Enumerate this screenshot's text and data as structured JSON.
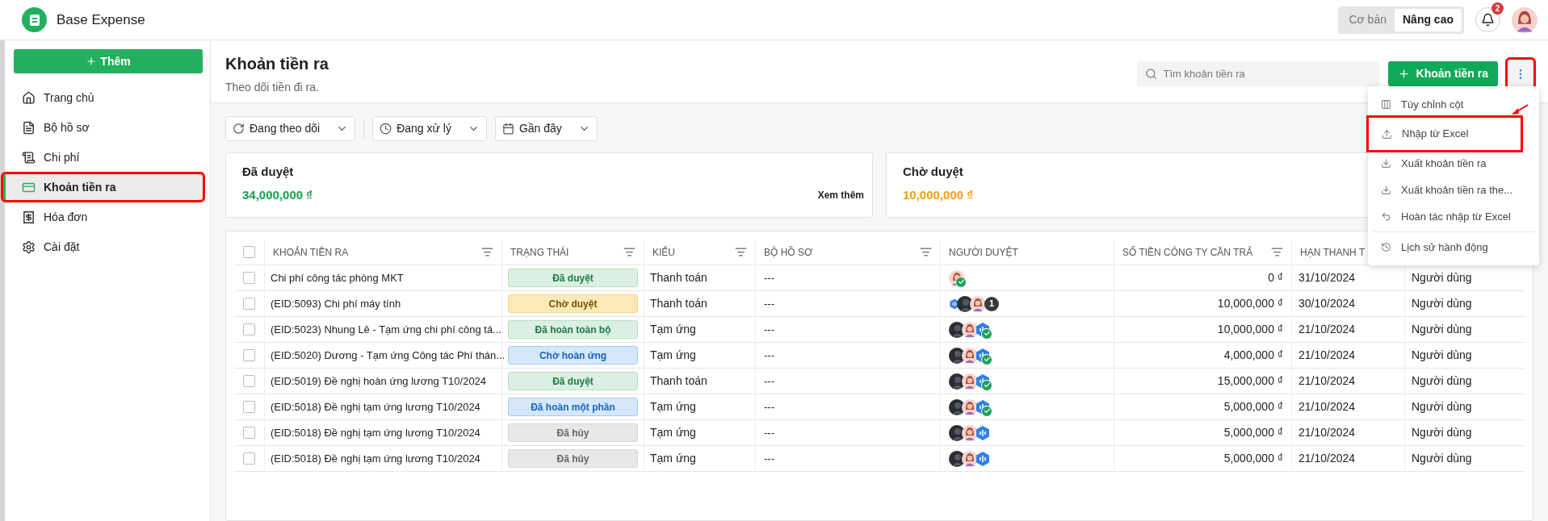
{
  "app": {
    "title": "Base Expense"
  },
  "mode_switch": [
    {
      "label": "Cơ bản",
      "selected": false
    },
    {
      "label": "Nâng cao",
      "selected": true
    }
  ],
  "notifications": {
    "count": "2"
  },
  "sidebar": {
    "add_button": "Thêm",
    "items": [
      {
        "label": "Trang chủ",
        "selected": false,
        "highlighted": false
      },
      {
        "label": "Bộ hồ sơ",
        "selected": false,
        "highlighted": false
      },
      {
        "label": "Chi phí",
        "selected": false,
        "highlighted": false
      },
      {
        "label": "Khoản tiền ra",
        "selected": true,
        "highlighted": true
      },
      {
        "label": "Hóa đơn",
        "selected": false,
        "highlighted": false
      },
      {
        "label": "Cài đặt",
        "selected": false,
        "highlighted": false
      }
    ]
  },
  "page": {
    "title": "Khoản tiền ra",
    "subtitle": "Theo dõi tiền đi ra.",
    "search": {
      "placeholder": "Tìm khoản tiền ra"
    },
    "add_button": "Khoản tiền ra",
    "more_highlighted": true
  },
  "filters": [
    {
      "label": "Đang theo dõi"
    },
    {
      "label": "Đang xử lý"
    },
    {
      "label": "Gần đây"
    }
  ],
  "summary_cards": [
    {
      "title": "Đã duyệt",
      "amount": "34,000,000 ₫",
      "color": "#16a34a",
      "link": "Xem thêm"
    },
    {
      "title": "Chờ duyệt",
      "amount": "10,000,000 ₫",
      "color": "#f59e0b"
    }
  ],
  "menu": [
    {
      "label": "Tùy chỉnh cột",
      "highlighted": false
    },
    {
      "label": "Nhập từ Excel",
      "highlighted": true
    },
    {
      "label": "Xuất khoản tiền ra",
      "highlighted": false
    },
    {
      "label": "Xuất khoản tiền ra the...",
      "highlighted": false
    },
    {
      "label": "Hoàn tác nhập từ Excel",
      "highlighted": false
    },
    {
      "label": "Lịch sử hành động",
      "highlighted": false
    }
  ],
  "table": {
    "all_checked": false,
    "columns": [
      {
        "label": "KHOẢN TIỀN RA",
        "filter": true
      },
      {
        "label": "TRẠNG THÁI",
        "filter": true
      },
      {
        "label": "KIỂU",
        "filter": true
      },
      {
        "label": "BỘ HỒ SƠ",
        "filter": true
      },
      {
        "label": "NGƯỜI DUYỆT",
        "filter": false
      },
      {
        "label": "SỐ TIỀN CÔNG TY CẦN TRẢ",
        "filter": true
      },
      {
        "label": "HẠN THANH T",
        "filter": false
      }
    ],
    "rows": [
      {
        "checked": false,
        "title": "Chi phí công tác phòng MKT",
        "status": {
          "label": "Đã duyệt",
          "kind": "green"
        },
        "type": "Thanh toán",
        "file": "---",
        "approvers": [
          {
            "kind": "light"
          }
        ],
        "approved": true,
        "amount": "0 ₫",
        "due": "31/10/2024",
        "column_9": "Người dùng"
      },
      {
        "checked": false,
        "title": "(EID:5093) Chi phí máy tính",
        "status": {
          "label": "Chờ duyệt",
          "kind": "yellow"
        },
        "type": "Thanh toán",
        "file": "---",
        "approvers": [
          {
            "kind": "hex-small"
          },
          {
            "kind": "dark"
          },
          {
            "kind": "light"
          }
        ],
        "more": "1",
        "approved": false,
        "amount": "10,000,000 ₫",
        "due": "30/10/2024",
        "column_9": "Người dùng"
      },
      {
        "checked": false,
        "title": "(EID:5023) Nhung Lê - Tạm ứng chi phí công tá...",
        "status": {
          "label": "Đã hoàn toàn bộ",
          "kind": "green"
        },
        "type": "Tạm ứng",
        "file": "---",
        "approvers": [
          {
            "kind": "dark"
          },
          {
            "kind": "light"
          },
          {
            "kind": "hex"
          }
        ],
        "approved": true,
        "amount": "10,000,000 ₫",
        "due": "21/10/2024",
        "column_9": "Người dùng"
      },
      {
        "checked": false,
        "title": "(EID:5020) Dương - Tạm ứng Công tác Phí thán...",
        "status": {
          "label": "Chờ hoàn ứng",
          "kind": "blue"
        },
        "type": "Tạm ứng",
        "file": "---",
        "approvers": [
          {
            "kind": "dark"
          },
          {
            "kind": "light"
          },
          {
            "kind": "hex"
          }
        ],
        "approved": true,
        "amount": "4,000,000 ₫",
        "due": "21/10/2024",
        "column_9": "Người dùng"
      },
      {
        "checked": false,
        "title": "(EID:5019) Đề nghị hoàn ứng lương T10/2024",
        "status": {
          "label": "Đã duyệt",
          "kind": "green"
        },
        "type": "Thanh toán",
        "file": "---",
        "approvers": [
          {
            "kind": "dark"
          },
          {
            "kind": "light"
          },
          {
            "kind": "hex"
          }
        ],
        "approved": true,
        "amount": "15,000,000 ₫",
        "due": "21/10/2024",
        "column_9": "Người dùng"
      },
      {
        "checked": false,
        "title": "(EID:5018) Đề nghị tạm ứng lương T10/2024",
        "status": {
          "label": "Đã hoàn một phần",
          "kind": "blue"
        },
        "type": "Tạm ứng",
        "file": "---",
        "approvers": [
          {
            "kind": "dark"
          },
          {
            "kind": "light"
          },
          {
            "kind": "hex"
          }
        ],
        "approved": true,
        "amount": "5,000,000 ₫",
        "due": "21/10/2024",
        "column_9": "Người dùng"
      },
      {
        "checked": false,
        "title": "(EID:5018) Đề nghị tạm ứng lương T10/2024",
        "status": {
          "label": "Đã hủy",
          "kind": "gray"
        },
        "type": "Tạm ứng",
        "file": "---",
        "approvers": [
          {
            "kind": "dark"
          },
          {
            "kind": "light"
          },
          {
            "kind": "hex"
          }
        ],
        "approved": false,
        "amount": "5,000,000 ₫",
        "due": "21/10/2024",
        "column_9": "Người dùng"
      },
      {
        "checked": false,
        "title": "(EID:5018) Đề nghị tạm ứng lương T10/2024",
        "status": {
          "label": "Đã hủy",
          "kind": "gray"
        },
        "type": "Tạm ứng",
        "file": "---",
        "approvers": [
          {
            "kind": "dark"
          },
          {
            "kind": "light"
          },
          {
            "kind": "hex"
          }
        ],
        "approved": false,
        "amount": "5,000,000 ₫",
        "due": "21/10/2024",
        "column_9": "Người dùng"
      }
    ]
  }
}
